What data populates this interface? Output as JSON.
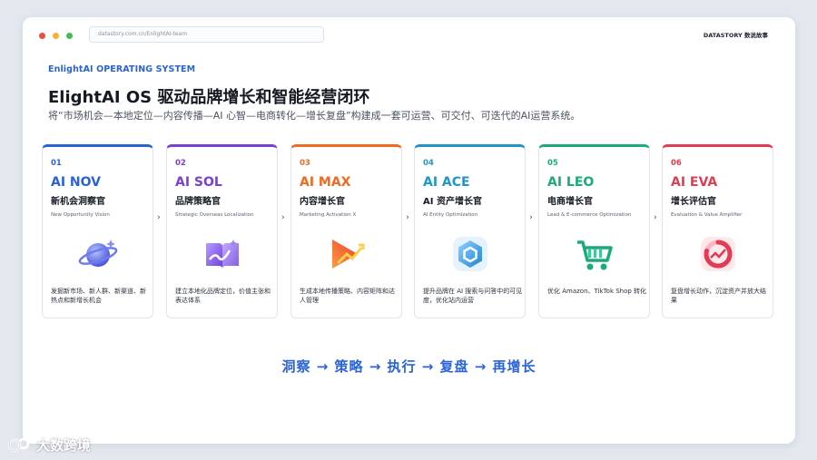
{
  "browser": {
    "url": "datastory.com.cn/EnlightAI-team",
    "brand": "DATASTORY 数说故事"
  },
  "header": {
    "eyebrow": "EnlightAI OPERATING SYSTEM",
    "title": "ElightAI OS 驱动品牌增长和智能经营闭环",
    "subtitle": "将“市场机会—本地定位—内容传播—AI 心智—电商转化—增长复盘”构建成一套可运营、可交付、可迭代的AI运营系统。"
  },
  "cards": [
    {
      "num": "01",
      "name": "AI NOV",
      "role": "新机会洞察官",
      "en": "New Opportunity Vision",
      "desc": "发掘新市场、新人群、新渠道、新热点和新增长机会",
      "color": "#2a63d8",
      "icon": "planet-icon"
    },
    {
      "num": "02",
      "name": "AI SOL",
      "role": "品牌策略官",
      "en": "Strategic Overseas Localization",
      "desc": "建立本地化品牌定位，价值主张和表达体系",
      "color": "#7a3fd6",
      "icon": "book-icon"
    },
    {
      "num": "03",
      "name": "AI MAX",
      "role": "内容增长官",
      "en": "Marketing Activation X",
      "desc": "生成本地传播策略、内容矩阵和达人管理",
      "color": "#ef6a1f",
      "icon": "arrow-chart-icon"
    },
    {
      "num": "04",
      "name": "AI ACE",
      "role": "AI 资产增长官",
      "en": "AI Entity Optimization",
      "desc": "提升品牌在 AI 搜索与问答中的可见度，优化站内运营",
      "color": "#1f96c9",
      "icon": "hexagon-icon"
    },
    {
      "num": "05",
      "name": "AI LEO",
      "role": "电商增长官",
      "en": "Lead & E-commerce Optimization",
      "desc": "优化 Amazon、TikTok Shop 转化",
      "color": "#1aab7a",
      "icon": "cart-icon"
    },
    {
      "num": "06",
      "name": "AI EVA",
      "role": "增长评估官",
      "en": "Evaluation & Value Amplifier",
      "desc": "复盘增长动作，沉淀资产并放大结果",
      "color": "#e23c52",
      "icon": "growth-ring-icon"
    }
  ],
  "flow": "洞察 → 策略 → 执行 → 复盘 → 再增长",
  "watermark": "大数跨境"
}
